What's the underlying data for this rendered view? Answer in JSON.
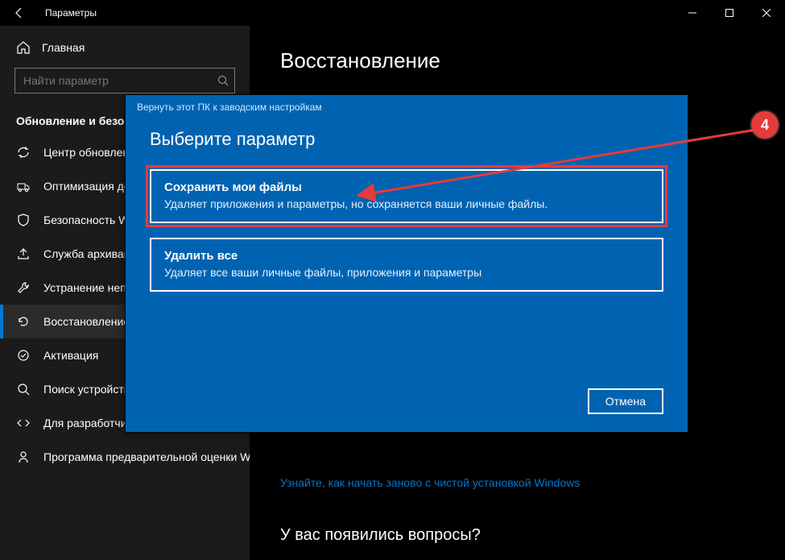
{
  "window": {
    "title": "Параметры"
  },
  "sidebar": {
    "home": "Главная",
    "search_placeholder": "Найти параметр",
    "section": "Обновление и безопасность",
    "items": [
      {
        "label": "Центр обновления Windows",
        "icon": "sync"
      },
      {
        "label": "Оптимизация доставки",
        "icon": "delivery"
      },
      {
        "label": "Безопасность Windows",
        "icon": "shield"
      },
      {
        "label": "Служба архивации",
        "icon": "backup"
      },
      {
        "label": "Устранение неполадок",
        "icon": "wrench"
      },
      {
        "label": "Восстановление",
        "icon": "recovery",
        "active": true
      },
      {
        "label": "Активация",
        "icon": "activation"
      },
      {
        "label": "Поиск устройства",
        "icon": "find"
      },
      {
        "label": "Для разработчиков",
        "icon": "dev"
      },
      {
        "label": "Программа предварительной оценки Windows",
        "icon": "insider"
      }
    ]
  },
  "page": {
    "heading": "Восстановление",
    "link": "Узнайте, как начать заново с чистой установкой Windows",
    "question": "У вас появились вопросы?"
  },
  "modal": {
    "title": "Вернуть этот ПК к заводским настройкам",
    "heading": "Выберите параметр",
    "options": [
      {
        "title": "Сохранить мои файлы",
        "desc": "Удаляет приложения и параметры, но сохраняется ваши личные файлы.",
        "highlight": true
      },
      {
        "title": "Удалить все",
        "desc": "Удаляет все ваши личные файлы, приложения и параметры"
      }
    ],
    "cancel": "Отмена"
  },
  "annotation": {
    "badge": "4"
  }
}
